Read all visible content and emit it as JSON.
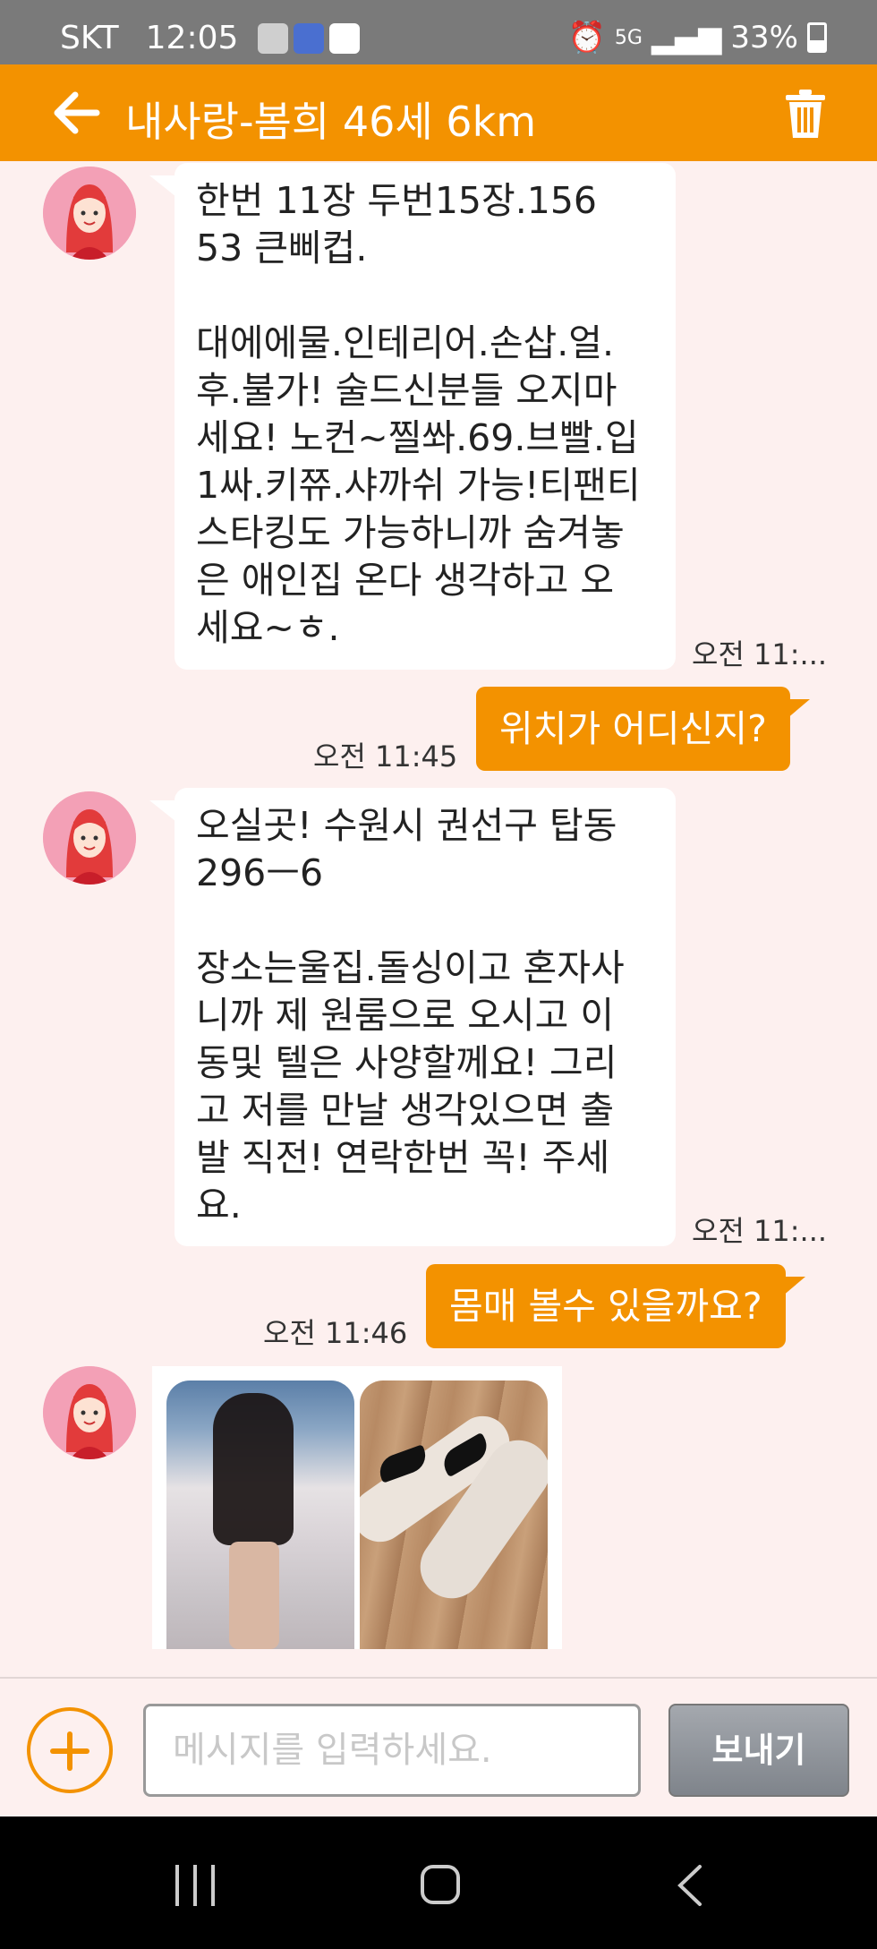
{
  "status_bar": {
    "carrier": "SKT",
    "time": "12:05",
    "network": "5G",
    "battery": "33%"
  },
  "header": {
    "title": "내사랑-봄희 46세 6km"
  },
  "messages": {
    "m1": {
      "line1": "한번 11장 두번15장.156",
      "line2": "53 큰삐컵.",
      "line3": "대에에물.인테리어.손삽.얼.",
      "line4": "후.불가! 술드신분들 오지마",
      "line5": "세요! 노컨~찔쏴.69.브빨.입",
      "line6": "1싸.키쮸.샤까쉬 가능!티팬티",
      "line7": "스타킹도 가능하니까 숨겨놓",
      "line8": "은 애인집 온다 생각하고 오",
      "line9": "세요~ㅎ.",
      "time": "오전 11:..."
    },
    "m2": {
      "text": "위치가 어디신지?",
      "time": "오전 11:45"
    },
    "m3": {
      "line1": "오실곳! 수원시 권선구 탑동",
      "line2": "296ㅡ6",
      "line3": "장소는울집.돌싱이고 혼자사",
      "line4": "니까 제 원룸으로 오시고 이",
      "line5": "동및 텔은 사양할께요! 그리",
      "line6": "고 저를 만날 생각있으면 출",
      "line7": "발 직전! 연락한번 꼭! 주세",
      "line8": "요.",
      "time": "오전 11:..."
    },
    "m4": {
      "text": "몸매 볼수 있을까요?",
      "time": "오전 11:46"
    }
  },
  "composer": {
    "placeholder": "메시지를 입력하세요.",
    "send_label": "보내기"
  },
  "colors": {
    "accent": "#f39200",
    "chat_background": "#fdf0ef",
    "status_bar": "#7a7a7a"
  }
}
